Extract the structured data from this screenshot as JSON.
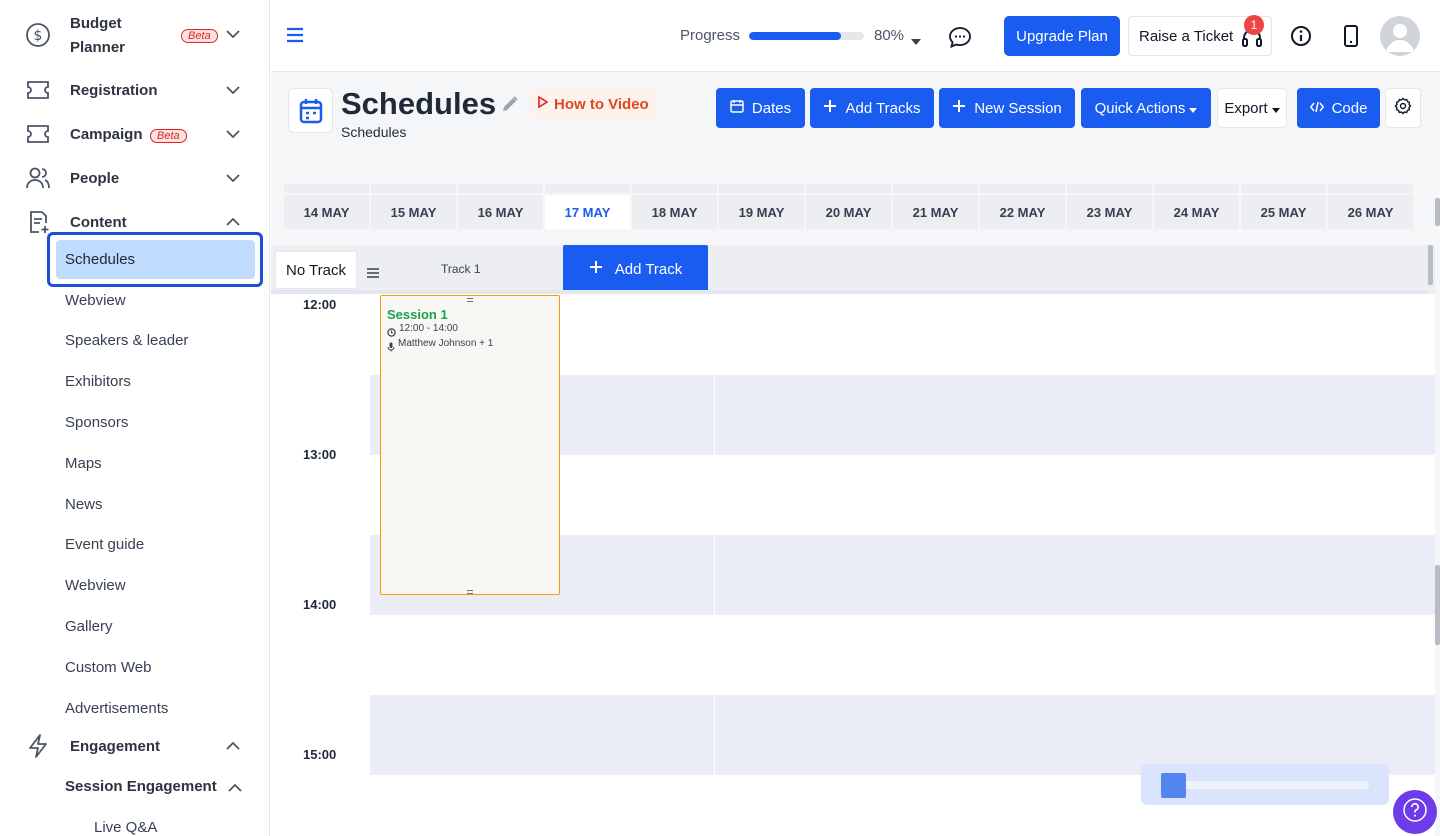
{
  "sidebar": {
    "budget_planner": "Budget\nPlanner",
    "budget_line1": "Budget",
    "budget_line2": "Planner",
    "beta": "Beta",
    "registration": "Registration",
    "campaign": "Campaign",
    "people": "People",
    "content": "Content",
    "content_items": [
      "Schedules",
      "Webview",
      "Speakers & leader",
      "Exhibitors",
      "Sponsors",
      "Maps",
      "News",
      "Event guide",
      "Webview",
      "Gallery",
      "Custom Web",
      "Advertisements"
    ],
    "engagement": "Engagement",
    "session_engagement": "Session Engagement",
    "live_qa": "Live Q&A"
  },
  "topbar": {
    "progress_label": "Progress",
    "progress_value": 0.8,
    "progress_text": "80%",
    "upgrade": "Upgrade Plan",
    "raise_ticket": "Raise a Ticket",
    "ticket_badge": "1"
  },
  "page": {
    "title": "Schedules",
    "subtitle": "Schedules",
    "how_to": "How to Video",
    "dates_btn": "Dates",
    "add_tracks_btn": "Add Tracks",
    "new_session_btn": "New Session",
    "quick_actions_btn": "Quick Actions",
    "export_btn": "Export",
    "code_btn": "Code"
  },
  "dates": [
    "14 MAY",
    "15 MAY",
    "16 MAY",
    "17 MAY",
    "18 MAY",
    "19 MAY",
    "20 MAY",
    "21 MAY",
    "22 MAY",
    "23 MAY",
    "24 MAY",
    "25 MAY",
    "26 MAY"
  ],
  "selected_date": "17 MAY",
  "tracks": {
    "no_track": "No Track",
    "track1": "Track 1",
    "add_track": "Add Track"
  },
  "times": [
    "12:00",
    "13:00",
    "14:00",
    "15:00"
  ],
  "session": {
    "title": "Session 1",
    "time": "12:00 - 14:00",
    "speaker": "Matthew Johnson + 1"
  },
  "colors": {
    "primary": "#1a5cf0",
    "session_title": "#16a34a",
    "session_border": "#f59e0b",
    "beta": "#dc2626"
  }
}
